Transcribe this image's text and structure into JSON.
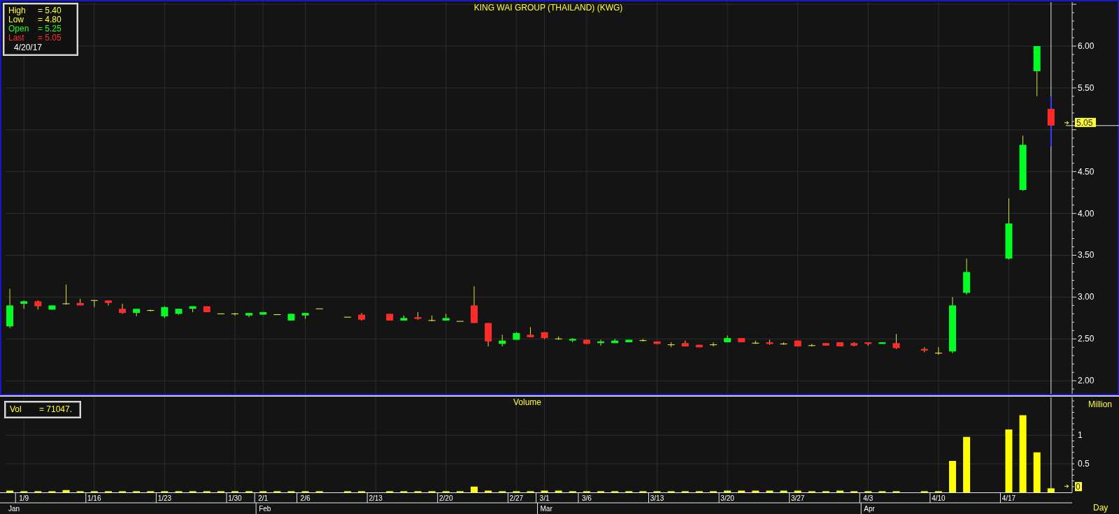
{
  "price_panel": {
    "legend": {
      "rows": [
        {
          "label": "High",
          "value": "= 5.40",
          "kind": "high"
        },
        {
          "label": "Low",
          "value": "= 4.80",
          "kind": "low"
        },
        {
          "label": "Open",
          "value": "= 5.25",
          "kind": "open"
        },
        {
          "label": "Last",
          "value": "= 5.05",
          "kind": "last"
        }
      ],
      "date": "4/20/17"
    },
    "last_price_marker": "5.05",
    "chart_data": {
      "type": "candlestick",
      "title": "KING WAI GROUP (THAILAND) (KWG)",
      "grid": true,
      "categories": [
        null,
        null,
        null,
        null,
        null,
        null,
        null,
        null,
        null,
        null,
        null,
        null,
        null,
        null,
        null,
        null,
        null,
        null,
        null,
        null,
        null,
        null,
        null,
        null,
        null,
        null,
        null,
        null,
        null,
        null,
        null,
        null,
        null,
        null,
        null,
        null,
        null,
        null,
        null,
        null,
        null,
        null,
        null,
        null,
        null,
        null,
        null,
        null,
        null,
        null,
        null,
        null,
        null,
        null,
        null,
        null,
        null,
        null,
        null,
        null,
        null,
        null,
        null,
        null,
        null,
        null,
        null,
        null,
        null,
        null,
        null,
        null,
        null,
        null,
        null,
        null
      ],
      "ohlc": [
        [
          2.65,
          3.1,
          2.63,
          2.9
        ],
        [
          2.92,
          2.96,
          2.86,
          2.95
        ],
        [
          2.95,
          2.96,
          2.85,
          2.89
        ],
        [
          2.85,
          2.9,
          2.85,
          2.9
        ],
        [
          2.92,
          3.15,
          2.91,
          2.92
        ],
        [
          2.93,
          2.98,
          2.9,
          2.9
        ],
        [
          2.96,
          2.96,
          2.88,
          2.96
        ],
        [
          2.96,
          2.96,
          2.9,
          2.93
        ],
        [
          2.86,
          2.92,
          2.8,
          2.81
        ],
        [
          2.81,
          2.86,
          2.77,
          2.86
        ],
        [
          2.84,
          2.85,
          2.83,
          2.84
        ],
        [
          2.77,
          2.89,
          2.75,
          2.88
        ],
        [
          2.8,
          2.86,
          2.79,
          2.86
        ],
        [
          2.86,
          2.89,
          2.82,
          2.89
        ],
        [
          2.89,
          2.89,
          2.82,
          2.82
        ],
        [
          2.8,
          2.8,
          2.8,
          2.8
        ],
        [
          2.8,
          2.81,
          2.78,
          2.8
        ],
        [
          2.78,
          2.81,
          2.76,
          2.81
        ],
        [
          2.79,
          2.82,
          2.79,
          2.82
        ],
        [
          2.79,
          2.79,
          2.79,
          2.79
        ],
        [
          2.72,
          2.8,
          2.72,
          2.8
        ],
        [
          2.78,
          2.81,
          2.74,
          2.81
        ],
        [
          2.86,
          2.86,
          2.86,
          2.86
        ],
        null,
        [
          2.76,
          2.76,
          2.76,
          2.76
        ],
        [
          2.79,
          2.81,
          2.72,
          2.73
        ],
        null,
        [
          2.8,
          2.8,
          2.72,
          2.72
        ],
        [
          2.72,
          2.78,
          2.72,
          2.75
        ],
        [
          2.76,
          2.82,
          2.73,
          2.74
        ],
        [
          2.72,
          2.78,
          2.71,
          2.72
        ],
        [
          2.72,
          2.8,
          2.72,
          2.75
        ],
        [
          2.71,
          2.71,
          2.71,
          2.71
        ],
        [
          2.9,
          3.13,
          2.69,
          2.69
        ],
        [
          2.69,
          2.69,
          2.41,
          2.47
        ],
        [
          2.44,
          2.55,
          2.41,
          2.48
        ],
        [
          2.49,
          2.58,
          2.49,
          2.57
        ],
        [
          2.55,
          2.64,
          2.52,
          2.52
        ],
        [
          2.58,
          2.58,
          2.5,
          2.51
        ],
        [
          2.5,
          2.53,
          2.49,
          2.5
        ],
        [
          2.48,
          2.51,
          2.46,
          2.5
        ],
        [
          2.49,
          2.49,
          2.44,
          2.44
        ],
        [
          2.45,
          2.49,
          2.42,
          2.47
        ],
        [
          2.45,
          2.5,
          2.45,
          2.48
        ],
        [
          2.46,
          2.49,
          2.46,
          2.49
        ],
        [
          2.48,
          2.5,
          2.47,
          2.48
        ],
        [
          2.47,
          2.47,
          2.44,
          2.44
        ],
        [
          2.43,
          2.46,
          2.4,
          2.43
        ],
        [
          2.45,
          2.48,
          2.41,
          2.41
        ],
        [
          2.43,
          2.43,
          2.4,
          2.4
        ],
        [
          2.43,
          2.46,
          2.41,
          2.43
        ],
        [
          2.46,
          2.54,
          2.46,
          2.51
        ],
        [
          2.51,
          2.51,
          2.46,
          2.46
        ],
        [
          2.45,
          2.48,
          2.44,
          2.45
        ],
        [
          2.46,
          2.49,
          2.43,
          2.44
        ],
        [
          2.44,
          2.46,
          2.43,
          2.44
        ],
        [
          2.48,
          2.48,
          2.41,
          2.41
        ],
        [
          2.42,
          2.44,
          2.41,
          2.42
        ],
        [
          2.45,
          2.45,
          2.42,
          2.42
        ],
        [
          2.46,
          2.46,
          2.41,
          2.41
        ],
        [
          2.45,
          2.46,
          2.41,
          2.42
        ],
        [
          2.46,
          2.46,
          2.42,
          2.44
        ],
        [
          2.44,
          2.46,
          2.44,
          2.46
        ],
        [
          2.45,
          2.56,
          2.38,
          2.39
        ],
        null,
        [
          2.38,
          2.4,
          2.34,
          2.36
        ],
        [
          2.33,
          2.4,
          2.31,
          2.33
        ],
        [
          2.35,
          3.0,
          2.33,
          2.9
        ],
        [
          3.05,
          3.46,
          3.03,
          3.3
        ],
        null,
        null,
        [
          3.46,
          4.18,
          3.45,
          3.88
        ],
        [
          4.28,
          4.93,
          4.27,
          4.82
        ],
        [
          5.7,
          6.0,
          5.4,
          6.0
        ],
        [
          5.25,
          5.4,
          4.8,
          5.05
        ],
        null
      ],
      "ylim": [
        1.843,
        6.526
      ],
      "yticks": [
        {
          "value": 2,
          "label": "2.00"
        },
        {
          "value": 2.5,
          "label": "2.50"
        },
        {
          "value": 3,
          "label": "3.00"
        },
        {
          "value": 3.5,
          "label": "3.50"
        },
        {
          "value": 4,
          "label": "4.00"
        },
        {
          "value": 4.5,
          "label": "4.50"
        },
        {
          "value": 5.5,
          "label": "5.50"
        },
        {
          "value": 6,
          "label": "6.00"
        }
      ]
    }
  },
  "volume_panel": {
    "legend": {
      "label": "Vol",
      "value": "= 71047."
    },
    "unit": "Million",
    "last_volume_marker": "0",
    "chart_data": {
      "type": "bar",
      "title": "Volume",
      "grid": true,
      "xlabel": "Day",
      "categories": [
        null,
        "1/9",
        null,
        null,
        null,
        null,
        "1/16",
        null,
        null,
        null,
        null,
        "1/23",
        null,
        null,
        null,
        null,
        "1/30",
        null,
        "2/1",
        null,
        null,
        "2/6",
        null,
        null,
        null,
        null,
        "2/13",
        null,
        null,
        null,
        null,
        "2/20",
        null,
        null,
        null,
        null,
        "2/27",
        null,
        "3/1",
        null,
        null,
        "3/6",
        null,
        null,
        null,
        null,
        "3/13",
        null,
        null,
        null,
        null,
        "3/20",
        null,
        null,
        null,
        null,
        "3/27",
        null,
        null,
        null,
        null,
        "4/3",
        null,
        null,
        null,
        null,
        "4/10",
        null,
        null,
        null,
        null,
        "4/17",
        null,
        null,
        null,
        null
      ],
      "values": [
        0.03,
        0.02,
        0.02,
        0.02,
        0.04,
        0.02,
        0.02,
        0.02,
        0.02,
        0.02,
        0.02,
        0.02,
        0.02,
        0.02,
        0.02,
        0.02,
        0.02,
        0.02,
        0.02,
        0.02,
        0.02,
        0.02,
        0.02,
        null,
        0.02,
        0.02,
        null,
        0.02,
        0.02,
        0.02,
        0.02,
        0.02,
        0.02,
        0.1,
        0.03,
        0.02,
        0.02,
        0.02,
        0.03,
        0.03,
        0.02,
        0.02,
        0.02,
        0.02,
        0.02,
        0.02,
        0.02,
        0.02,
        0.02,
        0.02,
        0.02,
        0.03,
        0.03,
        0.03,
        0.03,
        0.03,
        0.03,
        0.02,
        0.02,
        0.03,
        0.02,
        0.02,
        0.02,
        0.02,
        null,
        0.02,
        0.02,
        0.55,
        0.97,
        null,
        null,
        1.1,
        1.35,
        0.7,
        0.07,
        null
      ],
      "ylim": [
        0,
        1.65
      ],
      "yticks": [
        {
          "value": 0.5,
          "label": "0.5"
        },
        {
          "value": 1,
          "label": "1"
        }
      ],
      "annotations": [
        "Jan",
        "Feb",
        "Mar",
        "Apr"
      ]
    }
  }
}
